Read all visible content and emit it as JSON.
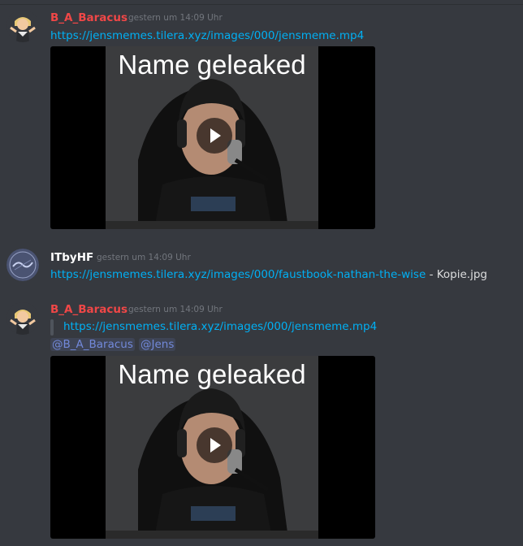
{
  "messages": [
    {
      "author": "B_A_Baracus",
      "timestamp": "gestern um 14:09 Uhr",
      "link": "https://jensmemes.tilera.xyz/images/000/jensmeme.mp4",
      "video": {
        "caption": "Name geleaked"
      }
    },
    {
      "author": "ITbyHF",
      "timestamp": "gestern um 14:09 Uhr",
      "link": "https://jensmemes.tilera.xyz/images/000/faustbook-nathan-the-wise",
      "link_suffix": " - Kopie.jpg"
    },
    {
      "author": "B_A_Baracus",
      "timestamp": "gestern um 14:09 Uhr",
      "quote_link": "https://jensmemes.tilera.xyz/images/000/jensmeme.mp4",
      "mentions": [
        "@B_A_Baracus",
        "@Jens"
      ],
      "video": {
        "caption": "Name geleaked"
      }
    }
  ],
  "colors": {
    "background": "#36393f",
    "author_baracus": "#f04747",
    "author_itbyhf": "#ffffff",
    "link": "#00b0f4",
    "mention": "#7289da",
    "timestamp": "#72767d"
  },
  "icons": [
    "shrug-emoji-avatar",
    "itbyhf-logo-avatar",
    "play-icon"
  ]
}
